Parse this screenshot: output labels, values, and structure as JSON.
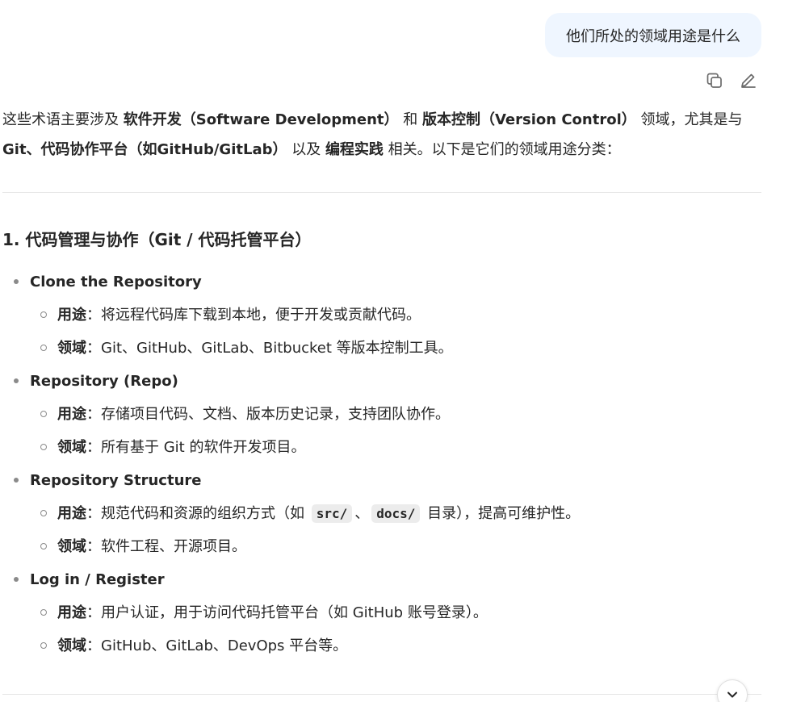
{
  "user_message": "他们所处的领域用途是什么",
  "actions": {
    "copy_icon": "copy-icon",
    "edit_icon": "edit-icon"
  },
  "intro": {
    "p1": "这些术语主要涉及 ",
    "b1": "软件开发（Software Development）",
    "p2": " 和 ",
    "b2": "版本控制（Version Control）",
    "p3": " 领域，尤其是与 ",
    "b3": "Git、代码协作平台（如GitHub/GitLab）",
    "p4": " 以及 ",
    "b4": "编程实践",
    "p5": " 相关。以下是它们的领域用途分类："
  },
  "section": {
    "title": "1. 代码管理与协作（Git / 代码托管平台）",
    "usage_label": "用途",
    "domain_label": "领域",
    "sep": "：",
    "items": [
      {
        "term": "Clone the Repository",
        "usage": "将远程代码库下载到本地，便于开发或贡献代码。",
        "domain": "Git、GitHub、GitLab、Bitbucket 等版本控制工具。"
      },
      {
        "term": "Repository (Repo)",
        "usage": "存储项目代码、文档、版本历史记录，支持团队协作。",
        "domain": "所有基于 Git 的软件开发项目。"
      },
      {
        "term": "Repository Structure",
        "usage_pre": "规范代码和资源的组织方式（如 ",
        "code1": "src/",
        "mid": "、",
        "code2": "docs/",
        "usage_post": " 目录），提高可维护性。",
        "domain": "软件工程、开源项目。"
      },
      {
        "term": "Log in / Register",
        "usage": "用户认证，用于访问代码托管平台（如 GitHub 账号登录）。",
        "domain": "GitHub、GitLab、DevOps 平台等。"
      }
    ]
  },
  "scroll_icon": "chevron-down-icon"
}
